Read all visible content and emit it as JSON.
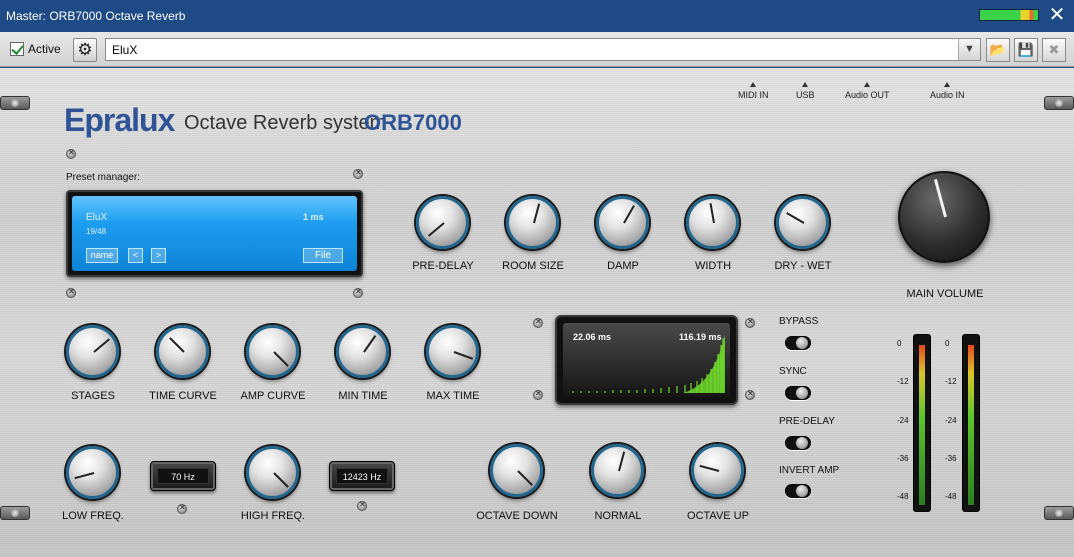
{
  "window": {
    "title": "Master: ORB7000 Octave Reverb"
  },
  "toolbar": {
    "active_label": "Active",
    "active_checked": true,
    "preset_value": "EluX"
  },
  "brand": {
    "name": "Epralux",
    "subtitle": "Octave Reverb system",
    "model": "ORB7000"
  },
  "io_labels": [
    "MIDI IN",
    "USB",
    "Audio OUT",
    "Audio IN"
  ],
  "preset_manager": {
    "label": "Preset manager:",
    "name": "EluX",
    "position": "19/48",
    "time": "1 ms",
    "name_button": "name",
    "prev_button": "<",
    "next_button": ">",
    "file_button": "File"
  },
  "top_knobs": [
    {
      "label": "PRE-DELAY"
    },
    {
      "label": "ROOM  SIZE"
    },
    {
      "label": "DAMP"
    },
    {
      "label": "WIDTH"
    },
    {
      "label": "DRY - WET"
    }
  ],
  "main_volume": {
    "label": "MAIN VOLUME"
  },
  "mid_knobs": [
    {
      "label": "STAGES"
    },
    {
      "label": "TIME CURVE"
    },
    {
      "label": "AMP CURVE"
    },
    {
      "label": "MIN TIME"
    },
    {
      "label": "MAX TIME"
    }
  ],
  "graph": {
    "min_time": "22.06 ms",
    "max_time": "116.19 ms"
  },
  "toggles": [
    "BYPASS",
    "SYNC",
    "PRE-DELAY",
    "INVERT AMP"
  ],
  "low_freq": {
    "label": "LOW FREQ.",
    "value": "70 Hz"
  },
  "high_freq": {
    "label": "HIGH FREQ.",
    "value": "12423 Hz"
  },
  "octave_knobs": [
    {
      "label": "OCTAVE DOWN"
    },
    {
      "label": "NORMAL"
    },
    {
      "label": "OCTAVE UP"
    }
  ],
  "vu_scale": [
    "0",
    "-12",
    "-24",
    "-36",
    "-48"
  ],
  "colors": {
    "titlebar": "#1e4a85",
    "brand": "#2f5496",
    "lcd": "#1e9ef0",
    "knob_ring": "#23678f"
  }
}
